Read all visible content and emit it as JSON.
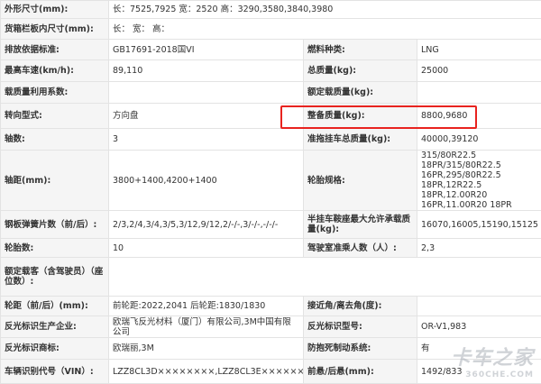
{
  "rows": [
    {
      "l1": "外形尺寸(mm):",
      "v1": "长：7525,7925 宽：2520 高：3290,3580,3840,3980"
    },
    {
      "l1": "货箱栏板内尺寸(mm):",
      "v1": "长：  宽：  高："
    },
    {
      "l1": "排放依据标准:",
      "v1": "GB17691-2018国VI",
      "l2": "燃料种类:",
      "v2": "LNG"
    },
    {
      "l1": "最高车速(km/h):",
      "v1": "89,110",
      "l2": "总质量(kg):",
      "v2": "25000"
    },
    {
      "l1": "载质量利用系数:",
      "v1": "",
      "l2": "额定载质量(kg):",
      "v2": ""
    },
    {
      "l1": "转向型式:",
      "v1": "方向盘",
      "l2": "整备质量(kg):",
      "v2": "8800,9680"
    },
    {
      "l1": "轴数:",
      "v1": "3",
      "l2": "准拖挂车总质量(kg):",
      "v2": "40000,39120"
    },
    {
      "l1": "轴距(mm):",
      "v1": "3800+1400,4200+1400",
      "l2": "轮胎规格:",
      "v2_lines": [
        "315/80R22.5",
        "18PR/315/80R22.5",
        "16PR,295/80R22.5",
        "18PR,12R22.5 18PR,12.00R20",
        "16PR,11.00R20 18PR"
      ]
    },
    {
      "l1": "钢板弹簧片数（前/后）:",
      "v1": "2/3,2/4,3/4,3/5,3/12,9/12,2/-/-,3/-/-,-/-/-",
      "l2": "半挂车鞍座最大允许承载质量(kg):",
      "v2": "16070,16005,15190,15125"
    },
    {
      "l1": "轮胎数:",
      "v1": "10",
      "l2": "驾驶室准乘人数（人）:",
      "v2": "2,3"
    },
    {
      "l1": "额定载客（含驾驶员）（座位数）:",
      "v1": ""
    },
    {
      "l1": "轮距（前/后）(mm):",
      "v1": "前轮距:2022,2041 后轮距:1830/1830",
      "l2": "接近角/离去角(度):",
      "v2": ""
    },
    {
      "l1": "反光标识生产企业:",
      "v1": "欧瑞飞反光材料（厦门）有限公司,3M中国有限公司",
      "l2": "反光标识型号:",
      "v2": "OR-V1,983"
    },
    {
      "l1": "反光标识商标:",
      "v1": "欧瑞丽,3M",
      "l2": "防抱死制动系统:",
      "v2": "有"
    },
    {
      "l1": "车辆识别代号（VIN）:",
      "v1": "LZZ8CL3D××××××××,LZZ8CL3E××××××××",
      "l2": "前悬/后悬(mm):",
      "v2": "1492/833"
    }
  ],
  "watermark": {
    "main": "卡车之家",
    "sub": "360CHE.COM"
  }
}
